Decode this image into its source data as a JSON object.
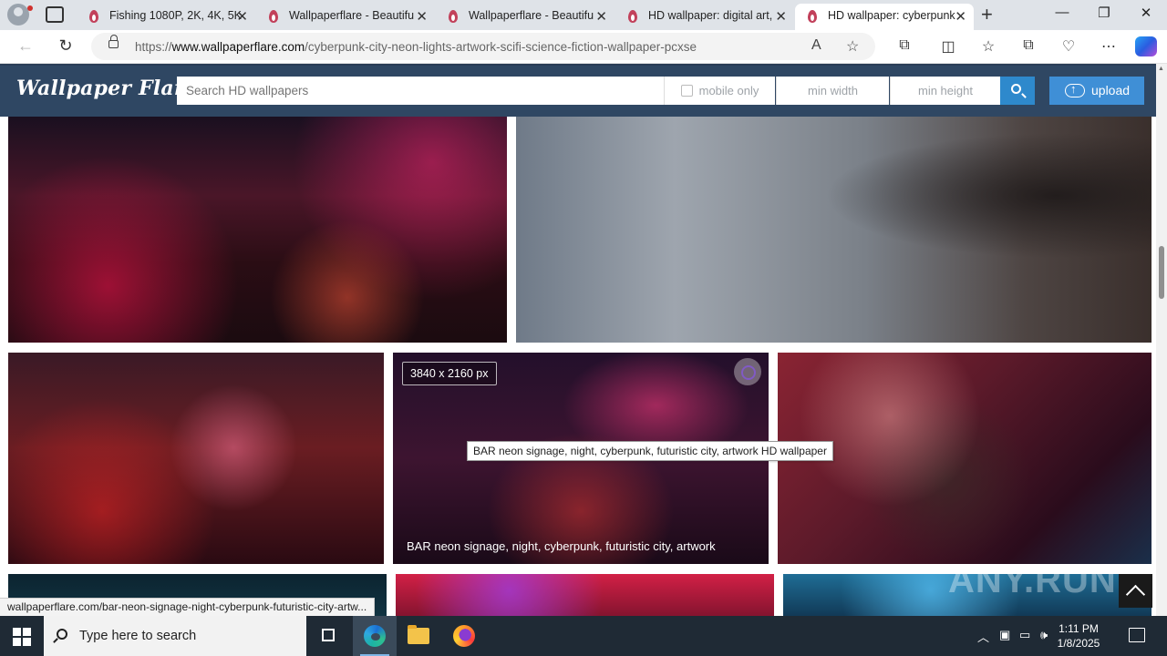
{
  "browser": {
    "tabs": [
      {
        "title": "Fishing 1080P, 2K, 4K, 5K",
        "active": false
      },
      {
        "title": "Wallpaperflare - Beautifu",
        "active": false
      },
      {
        "title": "Wallpaperflare - Beautifu",
        "active": false
      },
      {
        "title": "HD wallpaper: digital art,",
        "active": false
      },
      {
        "title": "HD wallpaper: cyberpunk",
        "active": true
      }
    ],
    "close_glyph": "✕",
    "new_tab_glyph": "+",
    "window_controls": {
      "minimize": "—",
      "restore": "❐",
      "close": "✕"
    },
    "url_domain": "www.wallpaperflare.com",
    "url_prefix": "https://",
    "url_path": "/cyberpunk-city-neon-lights-artwork-scifi-science-fiction-wallpaper-pcxse",
    "nav": {
      "back": "←",
      "refresh": "↻"
    },
    "toolbar_icons": [
      "read-aloud-icon",
      "favorite-star-icon",
      "extensions-icon",
      "split-screen-icon",
      "favorites-icon",
      "collections-icon",
      "browser-essentials-icon",
      "settings-more-icon",
      "copilot-icon"
    ],
    "toolbar_glyphs": {
      "read_aloud": "A",
      "favorite": "☆",
      "extensions": "⧉",
      "split": "◫",
      "favorites": "☆",
      "collections": "⧉",
      "essentials": "♡",
      "more": "⋯"
    }
  },
  "site": {
    "logo": "Wallpaper Flare",
    "search_placeholder": "Search HD wallpapers",
    "mobile_only_label": "mobile only",
    "min_width_placeholder": "min width",
    "min_height_placeholder": "min height",
    "upload_label": "upload"
  },
  "gallery": {
    "hovered_resolution": "3840 x 2160 px",
    "hovered_caption": "BAR neon signage, night, cyberpunk, futuristic city, artwork",
    "tooltip": "BAR neon signage, night, cyberpunk, futuristic city, artwork HD wallpaper"
  },
  "status_bar_link": "wallpaperflare.com/bar-neon-signage-night-cyberpunk-futuristic-city-artw...",
  "watermark": "ANY.RUN",
  "taskbar": {
    "search_placeholder": "Type here to search",
    "time": "1:11 PM",
    "date": "1/8/2025",
    "tray_glyphs": {
      "chevron": "︿",
      "meet": "▣",
      "network": "▭",
      "volume": "🕪"
    }
  }
}
